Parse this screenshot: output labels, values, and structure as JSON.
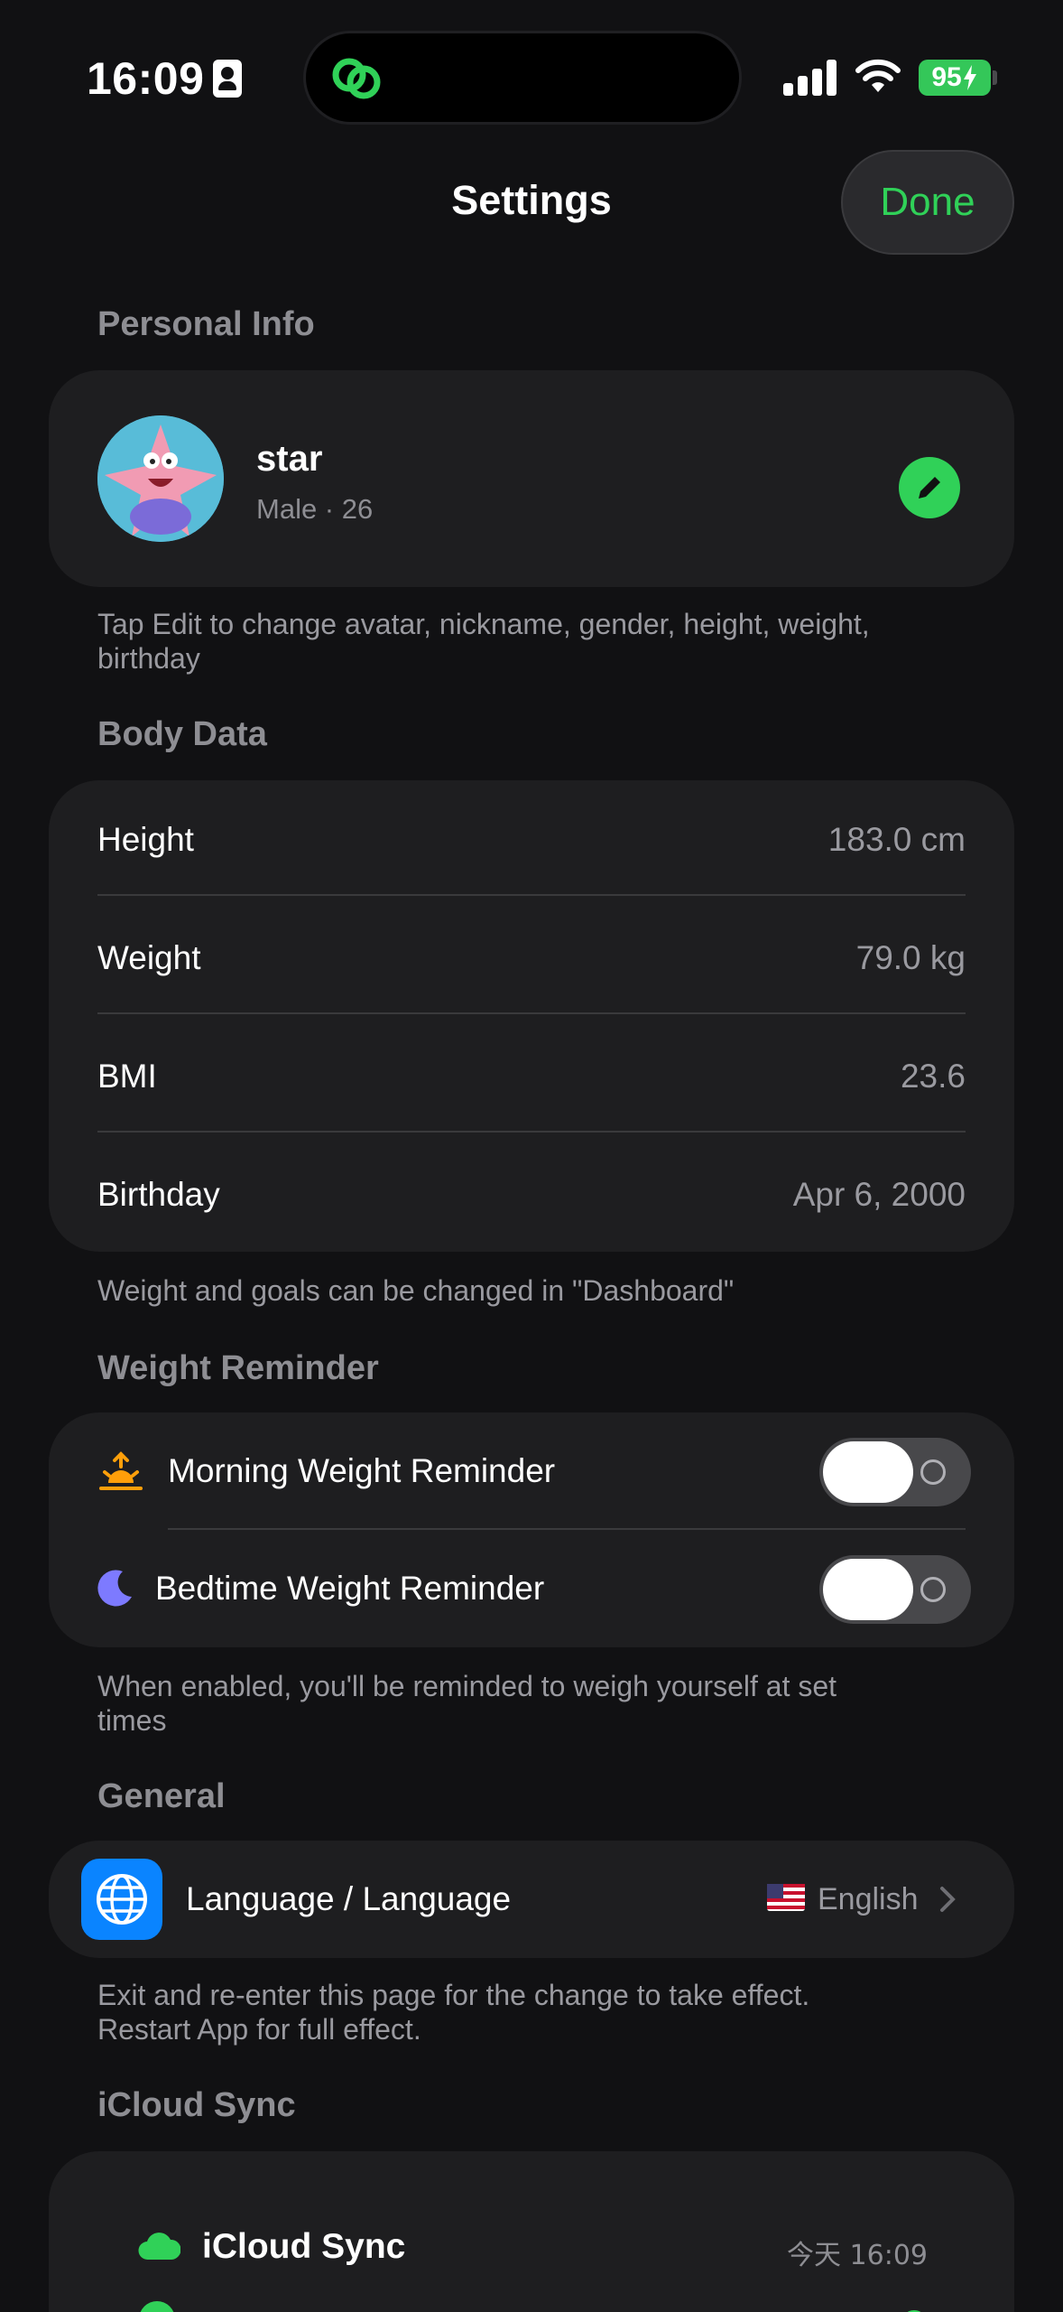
{
  "status_bar": {
    "time": "16:09",
    "battery": "95"
  },
  "nav": {
    "title": "Settings",
    "done_label": "Done"
  },
  "personal_info": {
    "header": "Personal Info",
    "name": "star",
    "subtitle": "Male · 26",
    "footnote": "Tap Edit to change avatar, nickname, gender, height, weight, birthday"
  },
  "body_data": {
    "header": "Body Data",
    "rows": [
      {
        "label": "Height",
        "value": "183.0 cm"
      },
      {
        "label": "Weight",
        "value": "79.0 kg"
      },
      {
        "label": "BMI",
        "value": "23.6"
      },
      {
        "label": "Birthday",
        "value": "Apr 6, 2000"
      }
    ],
    "footnote": "Weight and goals can be changed in \"Dashboard\""
  },
  "weight_reminder": {
    "header": "Weight Reminder",
    "morning_label": "Morning Weight Reminder",
    "bedtime_label": "Bedtime Weight Reminder",
    "morning_enabled": false,
    "bedtime_enabled": false,
    "footnote": "When enabled, you'll be reminded to weigh yourself at set times"
  },
  "general": {
    "header": "General",
    "language_label": "Language / Language",
    "language_value": "English",
    "footnote": "Exit and re-enter this page for the change to take effect. Restart App for full effect."
  },
  "icloud": {
    "header": "iCloud Sync",
    "sync_label": "iCloud Sync",
    "sync_time": "今天 16:09"
  },
  "colors": {
    "accent": "#30d158",
    "background": "#111113",
    "card": "#1e1e20",
    "language_icon_bg": "#0a84ff"
  }
}
